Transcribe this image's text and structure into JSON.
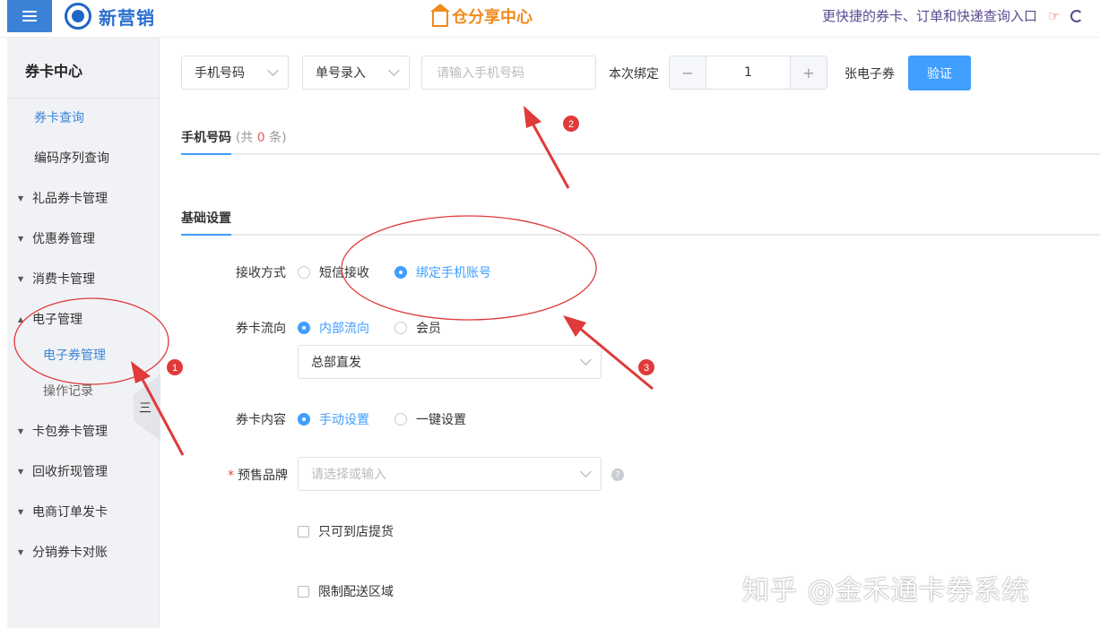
{
  "topbar": {
    "brand": "新营销",
    "center_title": "仓分享中心",
    "right_link": "更快捷的券卡、订单和快递查询入口"
  },
  "sidebar": {
    "title": "券卡中心",
    "items": [
      {
        "label": "券卡查询"
      },
      {
        "label": "编码序列查询"
      },
      {
        "label": "礼品券卡管理"
      },
      {
        "label": "优惠券管理"
      },
      {
        "label": "消费卡管理"
      },
      {
        "label": "电子管理"
      },
      {
        "label": "电子券管理"
      },
      {
        "label": "操作记录"
      },
      {
        "label": "卡包券卡管理"
      },
      {
        "label": "回收折现管理"
      },
      {
        "label": "电商订单发卡"
      },
      {
        "label": "分销券卡对账"
      }
    ],
    "collapse_glyph": "三"
  },
  "toolbar": {
    "select1": "手机号码",
    "select2": "单号录入",
    "phone_placeholder": "请输入手机号码",
    "bind_label": "本次绑定",
    "stepper_value": "1",
    "unit_label": "张电子券",
    "verify_label": "验证"
  },
  "tabs": {
    "phone_tab": "手机号码",
    "count_prefix": "(共",
    "count": "0",
    "count_suffix": "条)",
    "basic_tab": "基础设置"
  },
  "form": {
    "receive_label": "接收方式",
    "receive_opt1": "短信接收",
    "receive_opt2": "绑定手机账号",
    "flow_label": "券卡流向",
    "flow_opt1": "内部流向",
    "flow_opt2": "会员",
    "flow_select": "总部直发",
    "content_label": "券卡内容",
    "content_opt1": "手动设置",
    "content_opt2": "一键设置",
    "brand_label": "预售品牌",
    "brand_placeholder": "请选择或输入",
    "check1": "只可到店提货",
    "check2": "限制配送区域"
  },
  "annotations": {
    "marker1": "1",
    "marker2": "2",
    "marker3": "3"
  },
  "watermark": "知乎 @金禾通卡券系统",
  "colors": {
    "primary": "#409eff",
    "brand_blue": "#2a6fd0",
    "orange": "#f08a1c",
    "annotation_red": "#e03a3a"
  }
}
